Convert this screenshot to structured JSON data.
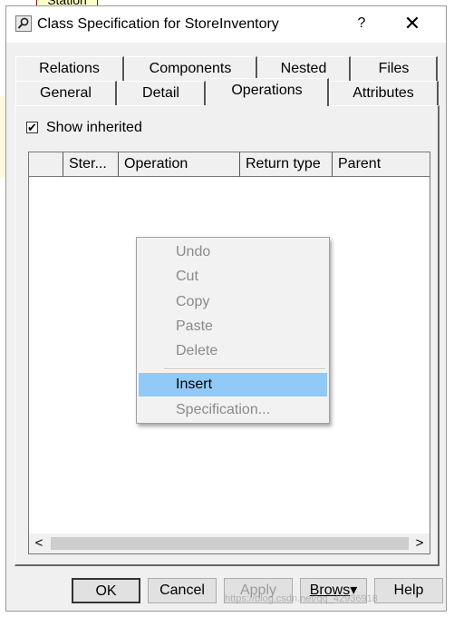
{
  "background": {
    "station_label": "Station"
  },
  "dialog": {
    "title": "Class Specification for StoreInventory",
    "help_glyph": "?",
    "close_glyph": "✕",
    "tabs_top": [
      "Relations",
      "Components",
      "Nested",
      "Files"
    ],
    "tabs_bottom": [
      "General",
      "Detail",
      "Operations",
      "Attributes"
    ],
    "active_tab": "Operations",
    "show_inherited": {
      "label": "Show inherited",
      "checked": true,
      "mark": "✔"
    },
    "columns": [
      "",
      "Ster...",
      "Operation",
      "Return type",
      "Parent"
    ],
    "scroll": {
      "left": "<",
      "right": ">"
    },
    "context_menu": {
      "items": [
        {
          "label": "Undo",
          "enabled": false
        },
        {
          "label": "Cut",
          "enabled": false
        },
        {
          "label": "Copy",
          "enabled": false
        },
        {
          "label": "Paste",
          "enabled": false
        },
        {
          "label": "Delete",
          "enabled": false
        },
        {
          "label": "Insert",
          "enabled": true,
          "highlighted": true
        },
        {
          "label": "Specification...",
          "enabled": false
        }
      ]
    },
    "buttons": {
      "ok": "OK",
      "cancel": "Cancel",
      "apply": "Apply",
      "browse": "Brows",
      "browse_arrow": "▾",
      "help": "Help"
    }
  },
  "watermark": "https://blog.csdn.net/qq_42936918",
  "colors": {
    "menu_highlight": "#91c9f7",
    "dialog_bg": "#f0f0f0"
  }
}
